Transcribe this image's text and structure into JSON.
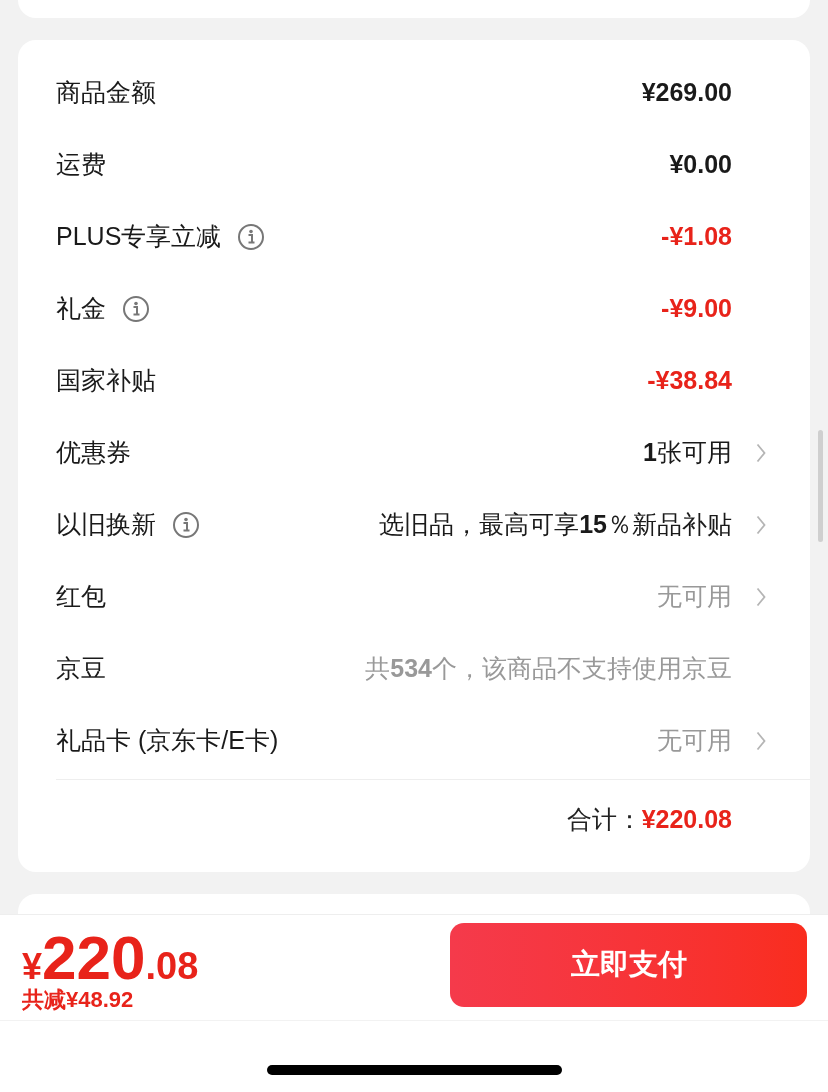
{
  "rows": [
    {
      "label": "商品金额",
      "info": false,
      "value": "¥269.00",
      "kind": "amount",
      "chevron": false
    },
    {
      "label": "运费",
      "info": false,
      "value": "¥0.00",
      "kind": "amount",
      "chevron": false
    },
    {
      "label": "PLUS专享立减",
      "info": true,
      "value": "-¥1.08",
      "kind": "discount",
      "chevron": false
    },
    {
      "label": "礼金",
      "info": true,
      "value": "-¥9.00",
      "kind": "discount",
      "chevron": false
    },
    {
      "label": "国家补贴",
      "info": false,
      "value": "-¥38.84",
      "kind": "discount",
      "chevron": false
    },
    {
      "label": "优惠券",
      "info": false,
      "value": "**1**张可用",
      "kind": "option",
      "chevron": true
    },
    {
      "label": "以旧换新",
      "info": true,
      "value": "选旧品，最高可享**15**％新品补贴",
      "kind": "option",
      "chevron": true
    },
    {
      "label": "红包",
      "info": false,
      "value": "无可用",
      "kind": "muted",
      "chevron": true
    },
    {
      "label": "京豆",
      "info": false,
      "value": "共**534**个，该商品不支持使用京豆",
      "kind": "muted",
      "chevron": false
    },
    {
      "label": "礼品卡 (京东卡/E卡)",
      "info": false,
      "value": "无可用",
      "kind": "muted",
      "chevron": true
    }
  ],
  "total": {
    "label": "合计：",
    "value": "¥220.08"
  },
  "footer": {
    "currency": "¥",
    "price_integer": "220",
    "price_decimal": ".08",
    "saving": "共减¥48.92",
    "pay_button": "立即支付"
  }
}
